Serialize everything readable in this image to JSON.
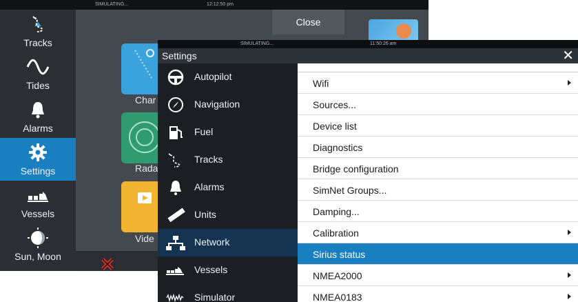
{
  "home": {
    "status": {
      "sim": "SIMULATING...",
      "clock": "12:12:50 pm"
    },
    "close_label": "Close",
    "sidebar": [
      {
        "label": "Tracks",
        "icon": "tracks-icon"
      },
      {
        "label": "Tides",
        "icon": "tides-icon"
      },
      {
        "label": "Alarms",
        "icon": "bell-icon"
      },
      {
        "label": "Settings",
        "icon": "gear-icon",
        "active": true
      },
      {
        "label": "Vessels",
        "icon": "vessels-icon"
      },
      {
        "label": "Sun, Moon",
        "icon": "sun-moon-icon"
      }
    ],
    "apps": [
      {
        "label": "Char",
        "icon": "chart-icon",
        "color": "#3aa2dc"
      },
      {
        "label": "Rada",
        "icon": "radar-icon",
        "color": "#2f9b6e"
      },
      {
        "label": "Vide",
        "icon": "video-icon",
        "color": "#f2b532"
      }
    ]
  },
  "settings": {
    "status": {
      "sim": "SIMULATING...",
      "clock": "11:50:26 am"
    },
    "title": "Settings",
    "close_glyph": "✕",
    "categories": [
      {
        "label": "Autopilot",
        "icon": "autopilot-icon"
      },
      {
        "label": "Navigation",
        "icon": "compass-icon"
      },
      {
        "label": "Fuel",
        "icon": "fuel-icon"
      },
      {
        "label": "Tracks",
        "icon": "tracks-icon"
      },
      {
        "label": "Alarms",
        "icon": "bell-icon"
      },
      {
        "label": "Units",
        "icon": "ruler-icon"
      },
      {
        "label": "Network",
        "icon": "network-icon",
        "active": true
      },
      {
        "label": "Vessels",
        "icon": "vessels-icon"
      },
      {
        "label": "Simulator",
        "icon": "simulator-icon"
      }
    ],
    "options": [
      {
        "label": "Wifi",
        "submenu": true
      },
      {
        "label": "Sources...",
        "submenu": false
      },
      {
        "label": "Device list",
        "submenu": false
      },
      {
        "label": "Diagnostics",
        "submenu": false
      },
      {
        "label": "Bridge configuration",
        "submenu": false
      },
      {
        "label": "SimNet Groups...",
        "submenu": false
      },
      {
        "label": "Damping...",
        "submenu": false
      },
      {
        "label": "Calibration",
        "submenu": true
      },
      {
        "label": "Sirius status",
        "submenu": false,
        "active": true
      },
      {
        "label": "NMEA2000",
        "submenu": true
      },
      {
        "label": "NMEA0183",
        "submenu": true
      }
    ]
  },
  "colors": {
    "accent": "#1a7fc0",
    "active_category": "#143350",
    "dialog_bg": "#1b1f24"
  }
}
